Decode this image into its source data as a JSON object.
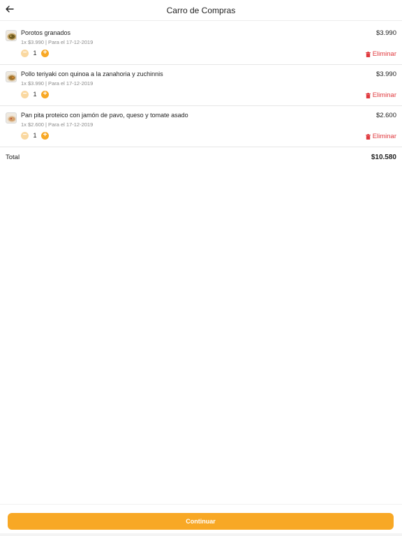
{
  "header": {
    "title": "Carro de Compras",
    "back_icon": "arrow-left-icon"
  },
  "items": [
    {
      "name": "Porotos granados",
      "meta": "1x $3.990 | Para el 17-12-2019",
      "price": "$3.990",
      "quantity": "1",
      "remove_label": "Eliminar",
      "thumb_color": "#8a6a2a"
    },
    {
      "name": "Pollo teriyaki con quinoa a la zanahoria y zuchinnis",
      "meta": "1x $3.990 | Para el 17-12-2019",
      "price": "$3.990",
      "quantity": "1",
      "remove_label": "Eliminar",
      "thumb_color": "#b07a30"
    },
    {
      "name": "Pan pita proteico con jamón de pavo, queso y tomate asado",
      "meta": "1x $2.600 | Para el 17-12-2019",
      "price": "$2.600",
      "quantity": "1",
      "remove_label": "Eliminar",
      "thumb_color": "#d9a878"
    }
  ],
  "total": {
    "label": "Total",
    "value": "$10.580"
  },
  "footer": {
    "continue_label": "Continuar"
  },
  "colors": {
    "accent": "#f8a825",
    "accent_light": "#fad8a0",
    "danger": "#e0393e"
  }
}
